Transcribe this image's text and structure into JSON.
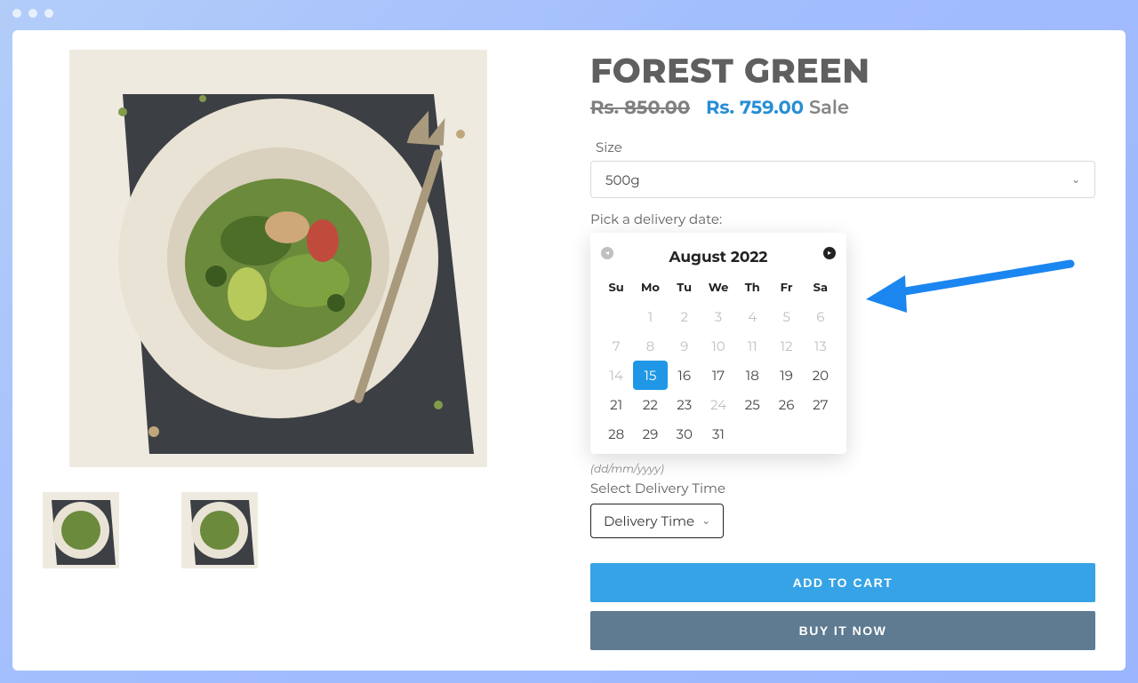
{
  "product": {
    "title": "FOREST GREEN",
    "old_price": "Rs. 850.00",
    "sale_price": "Rs. 759.00",
    "sale_label": "Sale"
  },
  "size": {
    "label": "Size",
    "value": "500g"
  },
  "delivery": {
    "pick_label": "Pick a delivery date:",
    "format_hint": "(dd/mm/yyyy)",
    "time_label": "Select Delivery Time",
    "time_value": "Delivery Time"
  },
  "calendar": {
    "title": "August 2022",
    "dow": [
      "Su",
      "Mo",
      "Tu",
      "We",
      "Th",
      "Fr",
      "Sa"
    ],
    "weeks": [
      [
        {
          "d": "",
          "disabled": true
        },
        {
          "d": "1",
          "disabled": true
        },
        {
          "d": "2",
          "disabled": true
        },
        {
          "d": "3",
          "disabled": true
        },
        {
          "d": "4",
          "disabled": true
        },
        {
          "d": "5",
          "disabled": true
        },
        {
          "d": "6",
          "disabled": true
        }
      ],
      [
        {
          "d": "7",
          "disabled": true
        },
        {
          "d": "8",
          "disabled": true
        },
        {
          "d": "9",
          "disabled": true
        },
        {
          "d": "10",
          "disabled": true
        },
        {
          "d": "11",
          "disabled": true
        },
        {
          "d": "12",
          "disabled": true
        },
        {
          "d": "13",
          "disabled": true
        }
      ],
      [
        {
          "d": "14",
          "disabled": true
        },
        {
          "d": "15",
          "selected": true
        },
        {
          "d": "16"
        },
        {
          "d": "17"
        },
        {
          "d": "18"
        },
        {
          "d": "19"
        },
        {
          "d": "20"
        }
      ],
      [
        {
          "d": "21"
        },
        {
          "d": "22"
        },
        {
          "d": "23"
        },
        {
          "d": "24",
          "disabled": true
        },
        {
          "d": "25"
        },
        {
          "d": "26"
        },
        {
          "d": "27"
        }
      ],
      [
        {
          "d": "28"
        },
        {
          "d": "29"
        },
        {
          "d": "30"
        },
        {
          "d": "31"
        },
        {
          "d": ""
        },
        {
          "d": ""
        },
        {
          "d": ""
        }
      ]
    ]
  },
  "buttons": {
    "add": "ADD TO CART",
    "buy": "BUY IT NOW"
  }
}
